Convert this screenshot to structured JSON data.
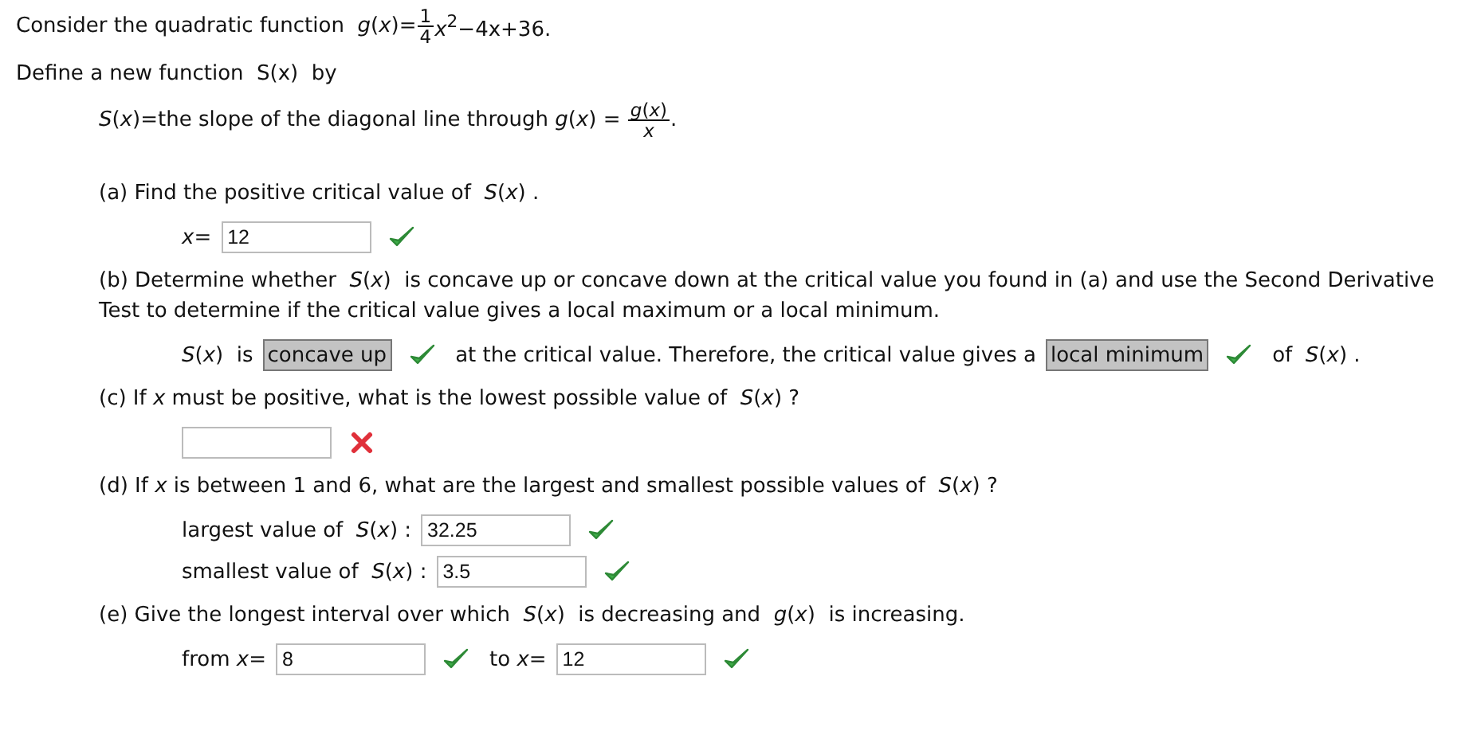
{
  "intro": {
    "text": "Consider the quadratic function",
    "formula_lhs": "*g*(*x*)=",
    "fraction": {
      "numerator": "1",
      "denominator": "4"
    },
    "formula_rhs": "*x*$^{2}$−4x+36."
  },
  "definition_intro": "Define a new function  S(x)  by",
  "definition": {
    "text": "*S*(*x*)=the slope of the diagonal line through *g*(*x*) =",
    "fraction": {
      "numerator": "*g*(*x*)",
      "denominator": "*x*"
    },
    "end": "."
  },
  "parts": [
    {
      "prompt": "(a) Find the positive critical value of  *S*(*x*) .",
      "rows": [
        {
          "items": [
            {
              "kind": "text",
              "text": "*x*="
            },
            {
              "kind": "input",
              "value": "12",
              "correct": true
            }
          ]
        }
      ]
    },
    {
      "prompt": "(b) Determine whether  *S*(*x*)  is concave up or concave down at the critical value you found in (a) and use the Second Derivative Test to determine if the critical value gives a local maximum or a local minimum.",
      "rows": [
        {
          "items": [
            {
              "kind": "text",
              "text": "*S*(*x*)  is"
            },
            {
              "kind": "select",
              "value": "concave up",
              "correct": true
            },
            {
              "kind": "text",
              "text": "at the critical value. Therefore, the critical value gives a"
            },
            {
              "kind": "select",
              "value": "local minimum",
              "correct": true
            },
            {
              "kind": "text",
              "text": "of  *S*(*x*) ."
            }
          ]
        }
      ]
    },
    {
      "prompt": "(c) If *x* must be positive, what is the lowest possible value of  *S*(*x*) ?",
      "rows": [
        {
          "items": [
            {
              "kind": "input",
              "correct": false
            }
          ]
        }
      ]
    },
    {
      "prompt": "(d) If *x* is between 1 and 6, what are the largest and smallest possible values of  *S*(*x*) ?",
      "rows": [
        {
          "items": [
            {
              "kind": "text",
              "text": "largest value of  *S*(*x*) :"
            },
            {
              "kind": "input",
              "value": "32.25",
              "correct": true
            }
          ]
        },
        {
          "items": [
            {
              "kind": "text",
              "text": "smallest value of  *S*(*x*) :"
            },
            {
              "kind": "input",
              "value": "3.5",
              "correct": true
            }
          ]
        }
      ]
    },
    {
      "prompt": "(e) Give the longest interval over which  *S*(*x*)  is decreasing and  *g*(*x*)  is increasing.",
      "rows": [
        {
          "items": [
            {
              "kind": "text",
              "text": "from *x*="
            },
            {
              "kind": "input",
              "value": "8",
              "correct": true
            },
            {
              "kind": "text",
              "text": "to *x*="
            },
            {
              "kind": "input",
              "value": "12",
              "correct": true
            }
          ]
        }
      ]
    }
  ]
}
